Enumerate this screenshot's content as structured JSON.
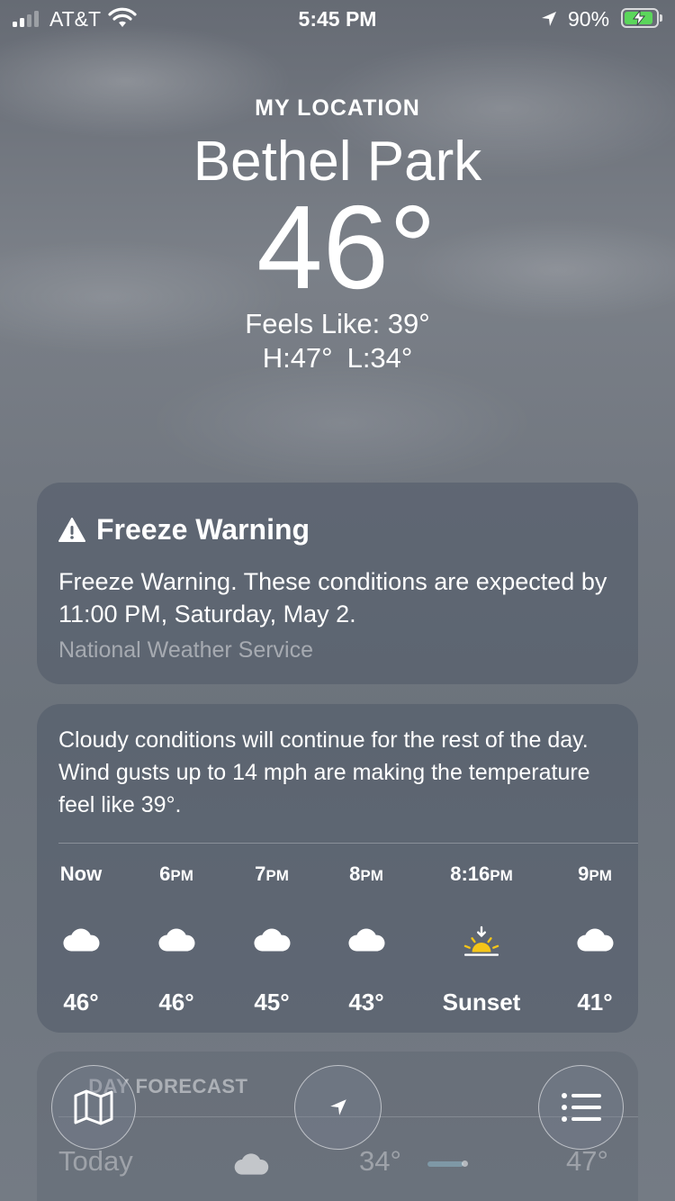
{
  "status_bar": {
    "carrier": "AT&T",
    "time": "5:45 PM",
    "battery_percent": "90%",
    "battery_level": 0.9,
    "signal_bars": 2,
    "charging": true
  },
  "header": {
    "location_label": "MY LOCATION",
    "city": "Bethel Park",
    "temperature": "46°",
    "feels_like": "Feels Like: 39°",
    "high": "H:47°",
    "low": "L:34°"
  },
  "alert": {
    "icon": "warning-triangle-icon",
    "title": "Freeze Warning",
    "body": "Freeze Warning. These conditions are expected by 11:00 PM, Saturday, May 2.",
    "source": "National Weather Service"
  },
  "hourly": {
    "summary": "Cloudy conditions will continue for the rest of the day. Wind gusts up to 14 mph are making the temperature feel like 39°.",
    "hours": [
      {
        "time": "Now",
        "suffix": "",
        "icon": "cloud-icon",
        "value": "46°"
      },
      {
        "time": "6",
        "suffix": "PM",
        "icon": "cloud-icon",
        "value": "46°"
      },
      {
        "time": "7",
        "suffix": "PM",
        "icon": "cloud-icon",
        "value": "45°"
      },
      {
        "time": "8",
        "suffix": "PM",
        "icon": "cloud-icon",
        "value": "43°"
      },
      {
        "time": "8:16",
        "suffix": "PM",
        "icon": "sunset-icon",
        "value": "Sunset"
      },
      {
        "time": "9",
        "suffix": "PM",
        "icon": "cloud-icon",
        "value": "41°"
      }
    ]
  },
  "daily": {
    "title": "DAY FORECAST",
    "rows": [
      {
        "day": "Today",
        "icon": "cloud-icon",
        "low": "34°",
        "high": "47°"
      }
    ]
  },
  "toolbar": {
    "map_icon": "map-icon",
    "location_icon": "location-arrow-icon",
    "list_icon": "list-icon"
  },
  "colors": {
    "battery_fill": "#5bd65b",
    "sunset_yellow": "#f5c518"
  }
}
